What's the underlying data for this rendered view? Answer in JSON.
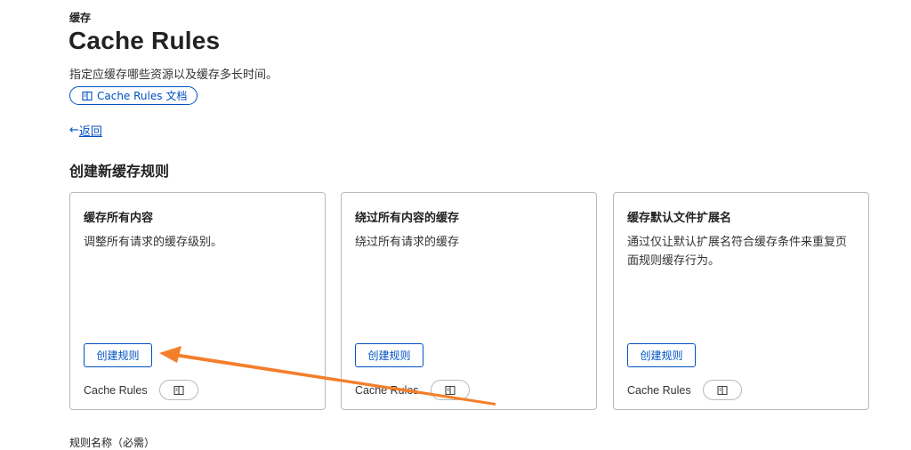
{
  "header": {
    "eyebrow": "缓存",
    "title": "Cache Rules",
    "description": "指定应缓存哪些资源以及缓存多长时间。",
    "doc_link_label": "Cache Rules 文档",
    "back_arrow": "←",
    "back_label": "返回"
  },
  "section": {
    "title": "创建新缓存规则"
  },
  "cards": [
    {
      "title": "缓存所有内容",
      "description": "调整所有请求的缓存级别。",
      "button_label": "创建规则",
      "footer_label": "Cache Rules"
    },
    {
      "title": "绕过所有内容的缓存",
      "description": "绕过所有请求的缓存",
      "button_label": "创建规则",
      "footer_label": "Cache Rules"
    },
    {
      "title": "缓存默认文件扩展名",
      "description": "通过仅让默认扩展名符合缓存条件来重复页面规则缓存行为。",
      "button_label": "创建规则",
      "footer_label": "Cache Rules"
    }
  ],
  "form": {
    "rule_name_label": "规则名称（必需）"
  },
  "annotation": {
    "arrow_color": "#f47e2a"
  },
  "colors": {
    "link": "#0051c3",
    "border": "#b9b9b9",
    "text": "#222222"
  },
  "icons": {
    "doc": "book-open-icon",
    "back": "left-arrow"
  }
}
